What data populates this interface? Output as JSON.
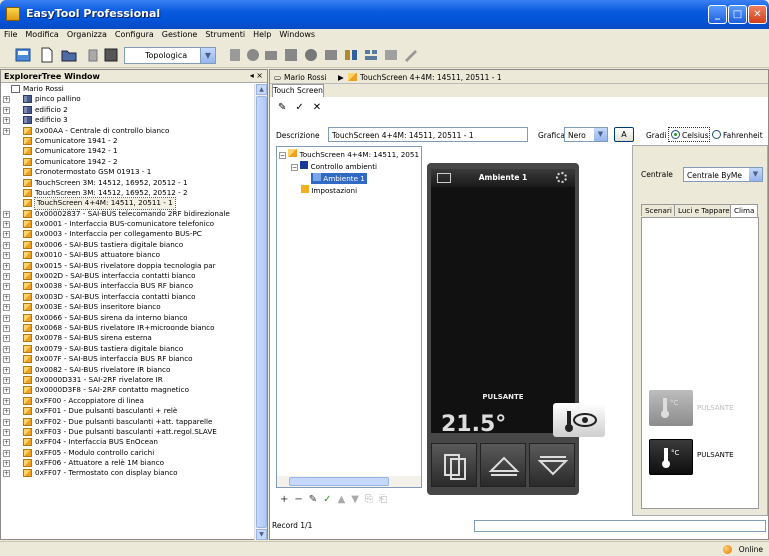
{
  "window": {
    "title": "EasyTool Professional",
    "minimize": "_",
    "maximize": "□",
    "close": "✕"
  },
  "menu": [
    "File",
    "Modifica",
    "Organizza",
    "Configura",
    "Gestione",
    "Strumenti",
    "Help",
    "Windows"
  ],
  "toolbar": {
    "view_select": "Topologica"
  },
  "explorer": {
    "title": "ExplorerTree Window",
    "controls": "◂ ×",
    "items": [
      {
        "label": "Mario Rossi",
        "icon": "page",
        "indent": 0,
        "exp": ""
      },
      {
        "label": "pinco pallino",
        "icon": "bldg",
        "indent": 1,
        "exp": "+"
      },
      {
        "label": "edificio 2",
        "icon": "bldg",
        "indent": 1,
        "exp": "+"
      },
      {
        "label": "edificio 3",
        "icon": "bldg",
        "indent": 1,
        "exp": "+"
      },
      {
        "label": "0x00AA - Centrale di controllo bianco",
        "icon": "folder",
        "indent": 1,
        "exp": "+"
      },
      {
        "label": "Comunicatore 1941 - 2",
        "icon": "folder",
        "indent": 1,
        "exp": ""
      },
      {
        "label": "Comunicatore 1942 - 1",
        "icon": "folder",
        "indent": 1,
        "exp": ""
      },
      {
        "label": "Comunicatore 1942 - 2",
        "icon": "folder",
        "indent": 1,
        "exp": ""
      },
      {
        "label": "Cronotermostato GSM 01913 - 1",
        "icon": "folder",
        "indent": 1,
        "exp": ""
      },
      {
        "label": "TouchScreen 3M: 14512, 16952, 20512 - 1",
        "icon": "folder",
        "indent": 1,
        "exp": ""
      },
      {
        "label": "TouchScreen 3M: 14512, 16952, 20512 - 2",
        "icon": "folder",
        "indent": 1,
        "exp": ""
      },
      {
        "label": "TouchScreen 4+4M: 14511, 20511 - 1",
        "icon": "folder",
        "indent": 1,
        "exp": "",
        "selected": true
      },
      {
        "label": "0x00002837 - SAI-BUS telecomando 2RF bidirezionale",
        "icon": "folder",
        "indent": 1,
        "exp": "+"
      },
      {
        "label": "0x0001 - Interfaccia BUS-comunicatore telefonico",
        "icon": "folder",
        "indent": 1,
        "exp": "+"
      },
      {
        "label": "0x0003 - Interfaccia per collegamento BUS-PC",
        "icon": "folder",
        "indent": 1,
        "exp": "+"
      },
      {
        "label": "0x0006 - SAI-BUS tastiera digitale bianco",
        "icon": "folder",
        "indent": 1,
        "exp": "+"
      },
      {
        "label": "0x0010 - SAI-BUS attuatore bianco",
        "icon": "folder",
        "indent": 1,
        "exp": "+"
      },
      {
        "label": "0x0015 - SAI-BUS rivelatore doppia tecnologia par",
        "icon": "folder",
        "indent": 1,
        "exp": "+"
      },
      {
        "label": "0x002D - SAI-BUS interfaccia contatti bianco",
        "icon": "folder",
        "indent": 1,
        "exp": "+"
      },
      {
        "label": "0x0038 - SAI-BUS interfaccia BUS RF bianco",
        "icon": "folder",
        "indent": 1,
        "exp": "+"
      },
      {
        "label": "0x003D - SAI-BUS interfaccia contatti bianco",
        "icon": "folder",
        "indent": 1,
        "exp": "+"
      },
      {
        "label": "0x003E - SAI-BUS inseritore bianco",
        "icon": "folder",
        "indent": 1,
        "exp": "+"
      },
      {
        "label": "0x0066 - SAI-BUS sirena da interno bianco",
        "icon": "folder",
        "indent": 1,
        "exp": "+"
      },
      {
        "label": "0x0068 - SAI-BUS rivelatore IR+microonde bianco",
        "icon": "folder",
        "indent": 1,
        "exp": "+"
      },
      {
        "label": "0x0078 - SAI-BUS sirena esterna",
        "icon": "folder",
        "indent": 1,
        "exp": "+"
      },
      {
        "label": "0x0079 - SAI-BUS tastiera digitale bianco",
        "icon": "folder",
        "indent": 1,
        "exp": "+"
      },
      {
        "label": "0x007F - SAI-BUS interfaccia BUS RF bianco",
        "icon": "folder",
        "indent": 1,
        "exp": "+"
      },
      {
        "label": "0x0082 - SAI-BUS rivelatore IR bianco",
        "icon": "folder",
        "indent": 1,
        "exp": "+"
      },
      {
        "label": "0x0000D331 - SAI-2RF rivelatore IR",
        "icon": "folder",
        "indent": 1,
        "exp": "+"
      },
      {
        "label": "0x0000D3F8 - SAI-2RF contatto magnetico",
        "icon": "folder",
        "indent": 1,
        "exp": "+"
      },
      {
        "label": "0xFF00 - Accoppiatore di linea",
        "icon": "folder",
        "indent": 1,
        "exp": "+"
      },
      {
        "label": "0xFF01 - Due pulsanti basculanti + relè",
        "icon": "folder",
        "indent": 1,
        "exp": "+"
      },
      {
        "label": "0xFF02 - Due pulsanti basculanti +att. tapparelle",
        "icon": "folder",
        "indent": 1,
        "exp": "+"
      },
      {
        "label": "0xFF03 - Due pulsanti basculanti +att.regol.SLAVE",
        "icon": "folder",
        "indent": 1,
        "exp": "+"
      },
      {
        "label": "0xFF04 - Interfaccia BUS EnOcean",
        "icon": "folder",
        "indent": 1,
        "exp": "+"
      },
      {
        "label": "0xFF05 - Modulo controllo carichi",
        "icon": "folder",
        "indent": 1,
        "exp": "+"
      },
      {
        "label": "0xFF06 - Attuatore a relè 1M bianco",
        "icon": "folder",
        "indent": 1,
        "exp": "+"
      },
      {
        "label": "0xFF07 - Termostato con display bianco",
        "icon": "folder",
        "indent": 1,
        "exp": "+"
      }
    ]
  },
  "breadcrumb": {
    "user": "Mario Rossi",
    "sep": "▶",
    "device": "TouchScreen 4+4M: 14511, 20511 - 1"
  },
  "tab": "Touch Screen",
  "form": {
    "descrizione_label": "Descrizione",
    "descrizione_value": "TouchScreen 4+4M: 14511, 20511 - 1",
    "grafica_label": "Grafica",
    "grafica_value": "Nero",
    "font_button": "A",
    "gradi_label": "Gradi",
    "celsius": "Celsius",
    "fahrenheit": "Fahrenheit"
  },
  "inner_tree": [
    {
      "label": "TouchScreen 4+4M: 14511, 2051",
      "level": 0
    },
    {
      "label": "Controllo ambienti",
      "level": 1
    },
    {
      "label": "Ambiente 1",
      "level": 2
    },
    {
      "label": "Impostazioni",
      "level": 1
    }
  ],
  "device": {
    "screen_title": "Ambiente 1",
    "button_label": "PULSANTE",
    "temperature": "21.5°"
  },
  "right": {
    "centrale_label": "Centrale",
    "centrale_value": "Centrale ByMe",
    "tabs": [
      "Scenari",
      "Luci e Tapparelle",
      "Clima"
    ],
    "btn_disabled_label": "PULSANTE",
    "btn_enabled_label": "PULSANTE"
  },
  "record": "Record 1/1",
  "status": "Online",
  "colors": {
    "title_blue": "#0a5ae0",
    "selection": "#316ac5",
    "device": "#474747"
  }
}
